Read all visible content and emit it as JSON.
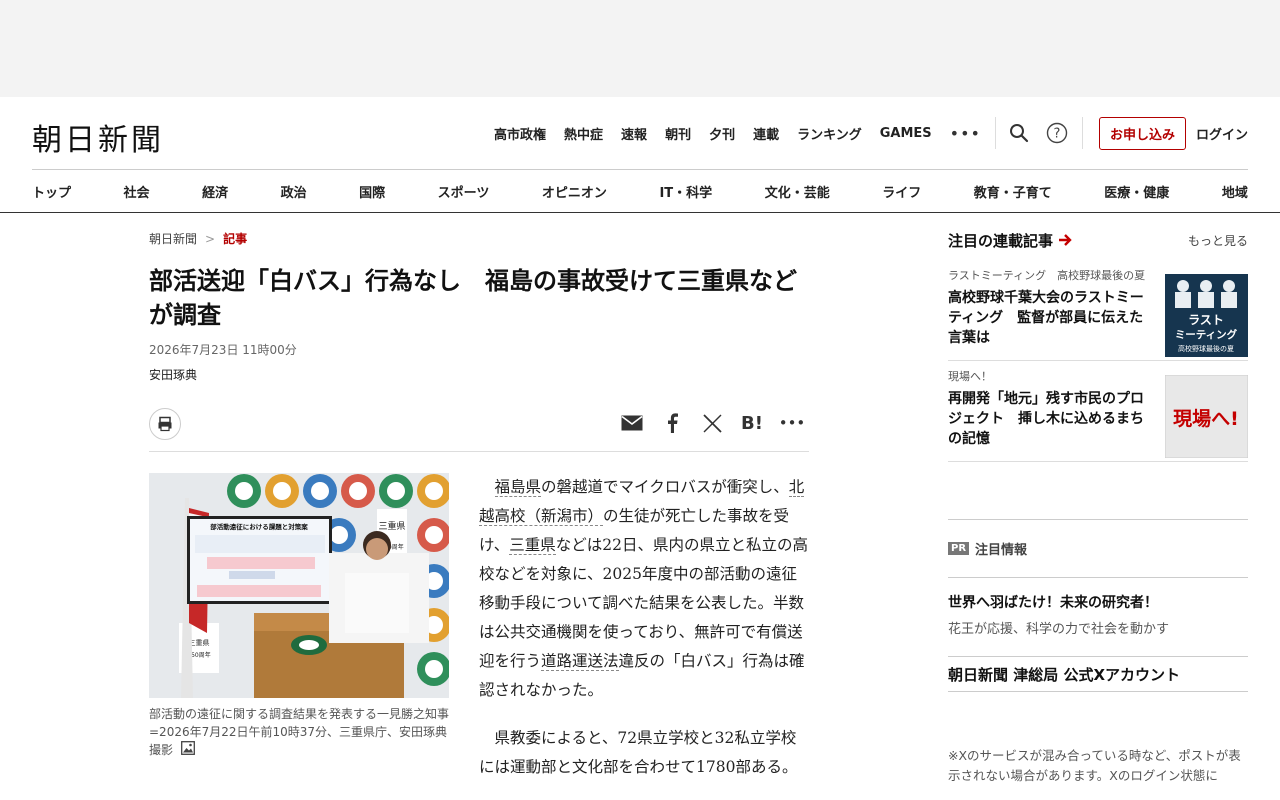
{
  "header": {
    "logo": "朝日新聞",
    "util_links": [
      "高市政権",
      "熱中症",
      "速報",
      "朝刊",
      "夕刊",
      "連載",
      "ランキング",
      "GAMES"
    ],
    "more": "•••",
    "subscribe": "お申し込み",
    "login": "ログイン",
    "nav": [
      "トップ",
      "社会",
      "経済",
      "政治",
      "国際",
      "スポーツ",
      "オピニオン",
      "IT・科学",
      "文化・芸能",
      "ライフ",
      "教育・子育て",
      "医療・健康",
      "地域"
    ]
  },
  "breadcrumb": {
    "home": "朝日新聞",
    "sep": ">",
    "current": "記事"
  },
  "article": {
    "title": "部活送迎「白バス」行為なし　福島の事故受けて三重県などが調査",
    "date": "2026年7月23日 11時00分",
    "author": "安田琢典",
    "caption": "部活動の遠征に関する調査結果を発表する一見勝之知事=2026年7月22日午前10時37分、三重県庁、安田琢典撮影",
    "p1": {
      "kw1": "福島県",
      "t1": "の磐越道でマイクロバスが衝突し、",
      "kw2": "北越高校（新潟市）",
      "t2": "の生徒が死亡した事故を受け、",
      "kw3": "三重県",
      "t3": "などは22日、県内の県立と私立の高校などを対象に、2025年度中の部活動の遠征移動手段について調べた結果を公表した。半数は公共交通機関を使っており、無許可で有償送迎を行う",
      "kw4": "道路運送法",
      "t4": "違反の「白バス」行為は確認されなかった。"
    },
    "p2": "県教委によると、72県立学校と32私立学校には運動部と文化部を合わせて1780部ある。",
    "photo_slide": {
      "title": "部活動遠征における課題と対策案",
      "banner": "三重県",
      "year": "150周年"
    }
  },
  "rail": {
    "title": "注目の連載記事",
    "more": "もっと見る",
    "items": [
      {
        "tag": "ラストミーティング　高校野球最後の夏",
        "title": "高校野球千葉大会のラストミーティング　監督が部員に伝えた言葉は",
        "thumb_text1": "ラスト",
        "thumb_text2": "ミーティング",
        "thumb_text3": "高校野球最後の夏"
      },
      {
        "tag": "現場へ！",
        "title": "再開発「地元」残す市民のプロジェクト　挿し木に込めるまちの記憶",
        "thumb_text1": "現場へ!"
      }
    ]
  },
  "pr": {
    "badge": "PR",
    "label": "注目情報",
    "item_title": "世界へ羽ばたけ！未来の研究者！",
    "item_sub": "花王が応援、科学の力で社会を動かす",
    "x_account": "朝日新聞 津総局 公式Xアカウント",
    "x_note": "※Xのサービスが混み合っている時など、ポストが表示されない場合があります。Xのログイン状態に"
  }
}
